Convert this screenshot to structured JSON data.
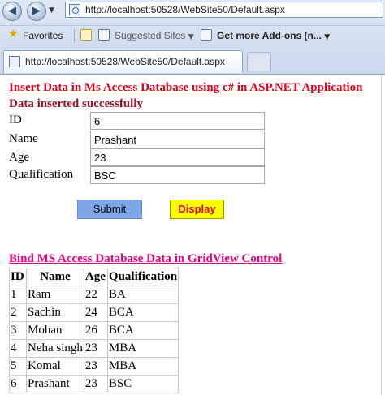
{
  "browser": {
    "address_url": "http://localhost:50528/WebSite50/Default.aspx",
    "favorites_label": "Favorites",
    "suggested_sites_label": "Suggested Sites",
    "addons_label": "Get more Add-ons (n...",
    "tab_title": "http://localhost:50528/WebSite50/Default.aspx",
    "icons": {
      "back": "back-arrow-icon",
      "forward": "forward-arrow-icon",
      "page": "ie-page-icon",
      "favorites": "star-icon"
    }
  },
  "page": {
    "heading_insert": "Insert Data in Ms Access Database using c# in ASP.NET Application",
    "status_message": "Data inserted successfully",
    "form": {
      "id_label": "ID",
      "id_value": "6",
      "name_label": "Name",
      "name_value": "Prashant",
      "age_label": "Age",
      "age_value": "23",
      "qualification_label": "Qualification",
      "qualification_value": "BSC"
    },
    "buttons": {
      "submit": "Submit",
      "display": "Display"
    },
    "heading_bind": "Bind MS Access Database Data in GridView Control",
    "grid": {
      "columns": [
        "ID",
        "Name",
        "Age",
        "Qualification"
      ],
      "rows": [
        [
          "1",
          "Ram",
          "22",
          "BA"
        ],
        [
          "2",
          "Sachin",
          "24",
          "BCA"
        ],
        [
          "3",
          "Mohan",
          "26",
          "BCA"
        ],
        [
          "4",
          "Neha singh",
          "23",
          "MBA"
        ],
        [
          "5",
          "Komal",
          "23",
          "MBA"
        ],
        [
          "6",
          "Prashant",
          "23",
          "BSC"
        ]
      ]
    },
    "colors": {
      "heading_red": "#e8001c",
      "status_maroon": "#9b0f24",
      "heading_pink": "#e0007f",
      "submit_bg": "#7fa7e8",
      "display_bg": "#ffff00"
    }
  }
}
